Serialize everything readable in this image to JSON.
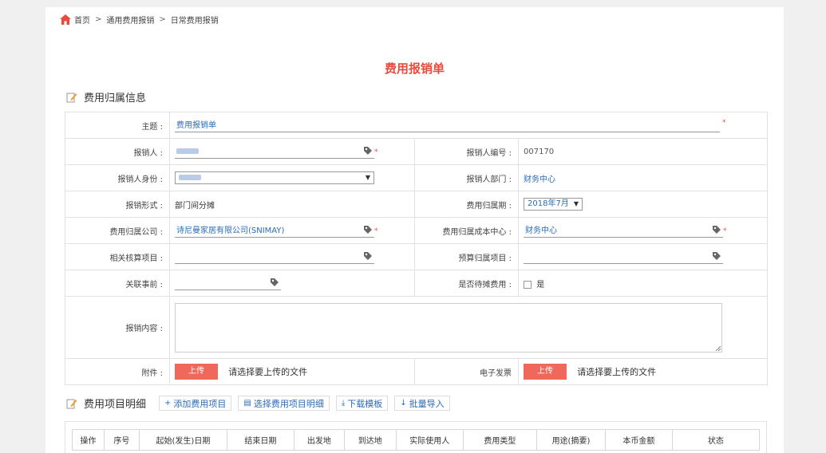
{
  "breadcrumb": {
    "home": "首页",
    "sep": ">",
    "level1": "通用费用报销",
    "level2": "日常费用报销"
  },
  "title": "费用报销单",
  "section1": {
    "heading": "费用归属信息"
  },
  "form": {
    "subject_label": "主题 :",
    "subject_value": "费用报销单",
    "required_mark": "*",
    "reimburser_label": "报销人 :",
    "reimburser_no_label": "报销人编号 :",
    "reimburser_no_value": "007170",
    "identity_label": "报销人身份 :",
    "department_label": "报销人部门 :",
    "department_value": "财务中心",
    "form_type_label": "报销形式 :",
    "form_type_value": "部门间分摊",
    "period_label": "费用归属期 :",
    "period_value": "2018年7月",
    "company_label": "费用归属公司 :",
    "company_value": "诗尼曼家居有限公司(SNIMAY)",
    "cost_center_label": "费用归属成本中心 :",
    "cost_center_value": "财务中心",
    "accounting_label": "相关核算项目 :",
    "budget_label": "预算归属项目 :",
    "related_label": "关联事前 :",
    "pending_label": "是否待摊费用 :",
    "pending_option": "是",
    "content_label": "报销内容 :",
    "attachment_label": "附件 :",
    "upload_label": "上传",
    "upload_hint": "请选择要上传的文件",
    "einvoice_label": "电子发票",
    "upload_label2": "上传",
    "upload_hint2": "请选择要上传的文件"
  },
  "section2": {
    "heading": "费用项目明细",
    "buttons": {
      "add": "添加费用项目",
      "select": "选择费用项目明细",
      "download": "下载模板",
      "import": "批量导入"
    }
  },
  "grid": {
    "columns": [
      "操作",
      "序号",
      "起始(发生)日期",
      "结束日期",
      "出发地",
      "到达地",
      "实际使用人",
      "费用类型",
      "用途(摘要)",
      "本币金额",
      "状态"
    ]
  },
  "colors": {
    "accent": "#e84c3d",
    "link": "#2b6cb8",
    "button": "#f0685c"
  }
}
